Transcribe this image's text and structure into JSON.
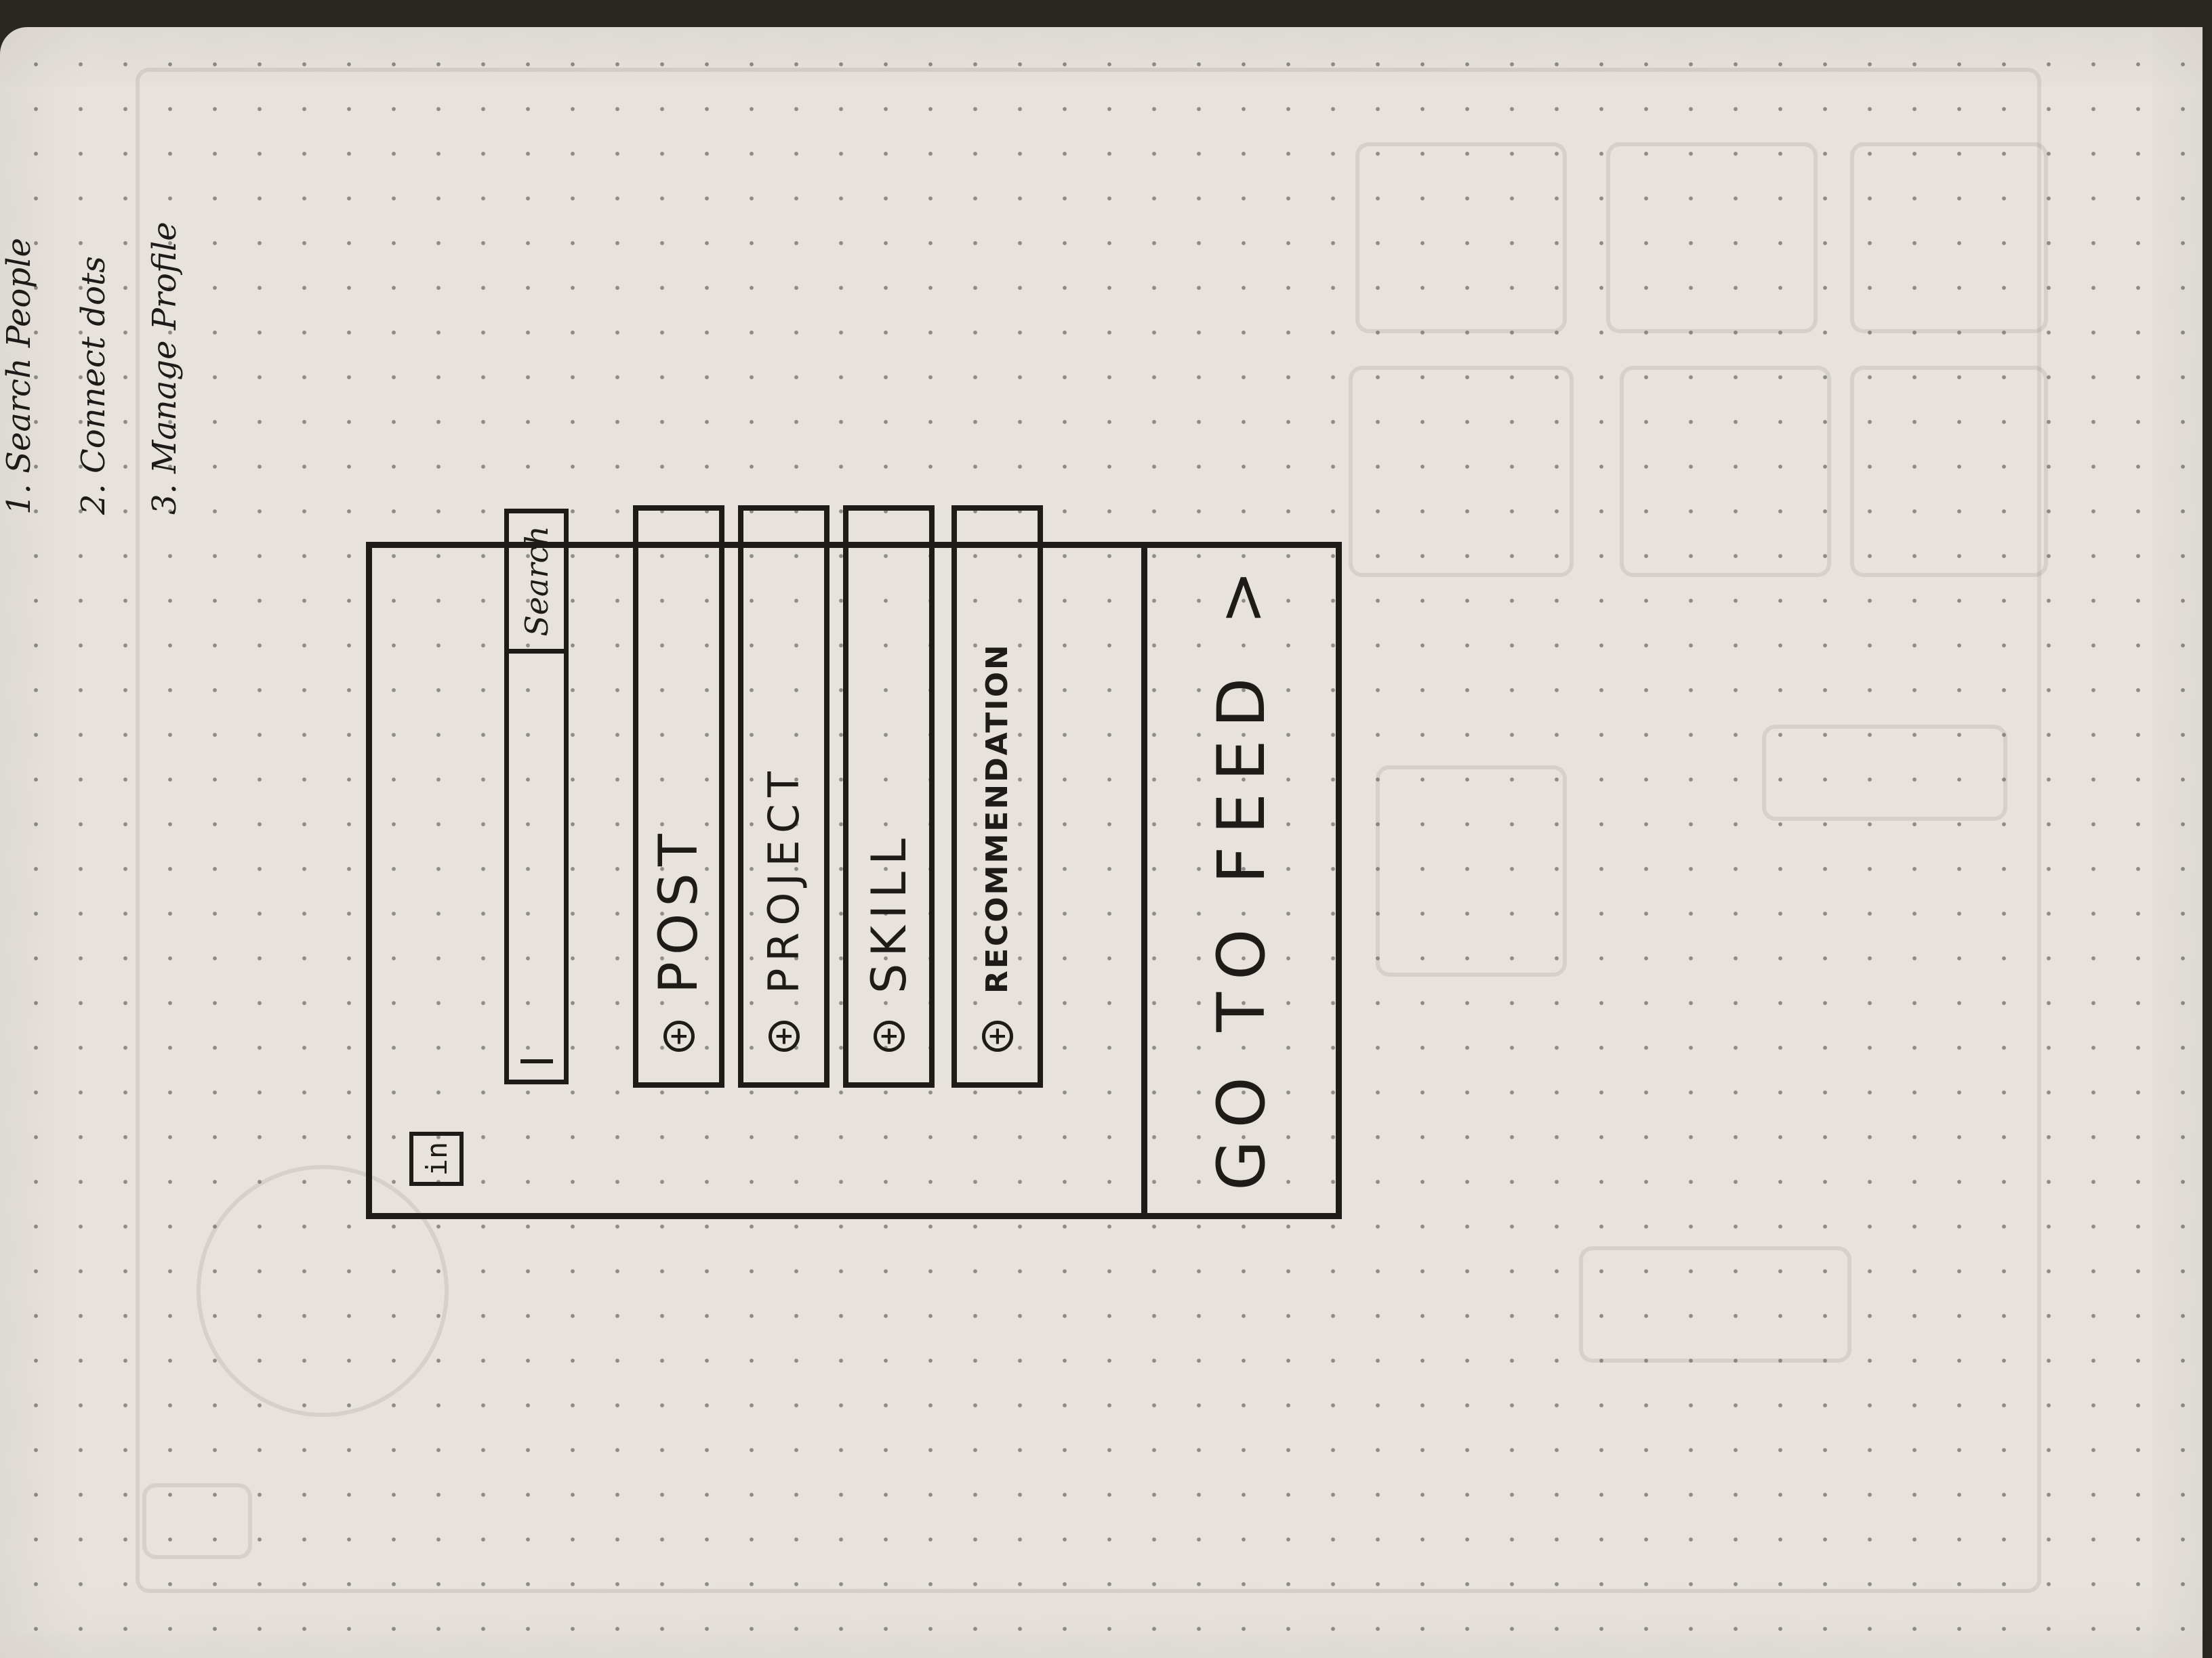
{
  "notes": [
    "1. Search People",
    "2. Connect dots",
    "3. Manage Profile"
  ],
  "header": {
    "logo": "in"
  },
  "search": {
    "value": "",
    "button_label": "Search"
  },
  "actions": [
    {
      "icon": "plus-circle-icon",
      "label": "POST"
    },
    {
      "icon": "plus-circle-icon",
      "label": "PROJECT"
    },
    {
      "icon": "plus-circle-icon",
      "label": "SKILL"
    },
    {
      "icon": "plus-circle-icon",
      "label": "RECOMMENDATION"
    }
  ],
  "footer": {
    "feed_label": "GO TO FEED",
    "feed_icon": "chevron-right-icon"
  },
  "colors": {
    "ink": "#1e1b18",
    "paper": "#e7e3dc"
  }
}
